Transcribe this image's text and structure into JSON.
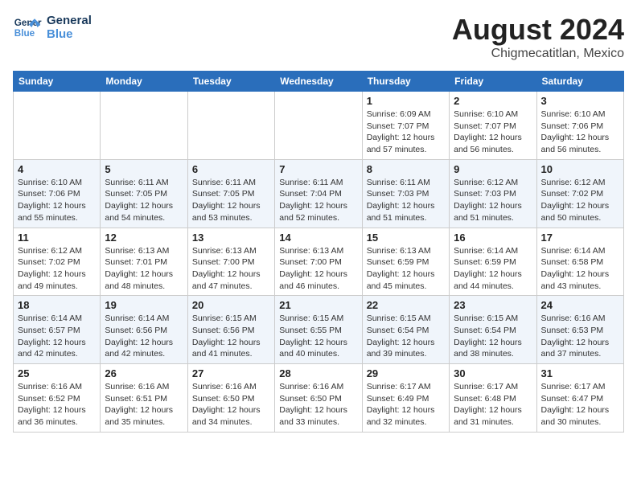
{
  "header": {
    "logo_line1": "General",
    "logo_line2": "Blue",
    "month_year": "August 2024",
    "location": "Chigmecatitlan, Mexico"
  },
  "days_of_week": [
    "Sunday",
    "Monday",
    "Tuesday",
    "Wednesday",
    "Thursday",
    "Friday",
    "Saturday"
  ],
  "weeks": [
    [
      {
        "day": "",
        "info": ""
      },
      {
        "day": "",
        "info": ""
      },
      {
        "day": "",
        "info": ""
      },
      {
        "day": "",
        "info": ""
      },
      {
        "day": "1",
        "info": "Sunrise: 6:09 AM\nSunset: 7:07 PM\nDaylight: 12 hours\nand 57 minutes."
      },
      {
        "day": "2",
        "info": "Sunrise: 6:10 AM\nSunset: 7:07 PM\nDaylight: 12 hours\nand 56 minutes."
      },
      {
        "day": "3",
        "info": "Sunrise: 6:10 AM\nSunset: 7:06 PM\nDaylight: 12 hours\nand 56 minutes."
      }
    ],
    [
      {
        "day": "4",
        "info": "Sunrise: 6:10 AM\nSunset: 7:06 PM\nDaylight: 12 hours\nand 55 minutes."
      },
      {
        "day": "5",
        "info": "Sunrise: 6:11 AM\nSunset: 7:05 PM\nDaylight: 12 hours\nand 54 minutes."
      },
      {
        "day": "6",
        "info": "Sunrise: 6:11 AM\nSunset: 7:05 PM\nDaylight: 12 hours\nand 53 minutes."
      },
      {
        "day": "7",
        "info": "Sunrise: 6:11 AM\nSunset: 7:04 PM\nDaylight: 12 hours\nand 52 minutes."
      },
      {
        "day": "8",
        "info": "Sunrise: 6:11 AM\nSunset: 7:03 PM\nDaylight: 12 hours\nand 51 minutes."
      },
      {
        "day": "9",
        "info": "Sunrise: 6:12 AM\nSunset: 7:03 PM\nDaylight: 12 hours\nand 51 minutes."
      },
      {
        "day": "10",
        "info": "Sunrise: 6:12 AM\nSunset: 7:02 PM\nDaylight: 12 hours\nand 50 minutes."
      }
    ],
    [
      {
        "day": "11",
        "info": "Sunrise: 6:12 AM\nSunset: 7:02 PM\nDaylight: 12 hours\nand 49 minutes."
      },
      {
        "day": "12",
        "info": "Sunrise: 6:13 AM\nSunset: 7:01 PM\nDaylight: 12 hours\nand 48 minutes."
      },
      {
        "day": "13",
        "info": "Sunrise: 6:13 AM\nSunset: 7:00 PM\nDaylight: 12 hours\nand 47 minutes."
      },
      {
        "day": "14",
        "info": "Sunrise: 6:13 AM\nSunset: 7:00 PM\nDaylight: 12 hours\nand 46 minutes."
      },
      {
        "day": "15",
        "info": "Sunrise: 6:13 AM\nSunset: 6:59 PM\nDaylight: 12 hours\nand 45 minutes."
      },
      {
        "day": "16",
        "info": "Sunrise: 6:14 AM\nSunset: 6:59 PM\nDaylight: 12 hours\nand 44 minutes."
      },
      {
        "day": "17",
        "info": "Sunrise: 6:14 AM\nSunset: 6:58 PM\nDaylight: 12 hours\nand 43 minutes."
      }
    ],
    [
      {
        "day": "18",
        "info": "Sunrise: 6:14 AM\nSunset: 6:57 PM\nDaylight: 12 hours\nand 42 minutes."
      },
      {
        "day": "19",
        "info": "Sunrise: 6:14 AM\nSunset: 6:56 PM\nDaylight: 12 hours\nand 42 minutes."
      },
      {
        "day": "20",
        "info": "Sunrise: 6:15 AM\nSunset: 6:56 PM\nDaylight: 12 hours\nand 41 minutes."
      },
      {
        "day": "21",
        "info": "Sunrise: 6:15 AM\nSunset: 6:55 PM\nDaylight: 12 hours\nand 40 minutes."
      },
      {
        "day": "22",
        "info": "Sunrise: 6:15 AM\nSunset: 6:54 PM\nDaylight: 12 hours\nand 39 minutes."
      },
      {
        "day": "23",
        "info": "Sunrise: 6:15 AM\nSunset: 6:54 PM\nDaylight: 12 hours\nand 38 minutes."
      },
      {
        "day": "24",
        "info": "Sunrise: 6:16 AM\nSunset: 6:53 PM\nDaylight: 12 hours\nand 37 minutes."
      }
    ],
    [
      {
        "day": "25",
        "info": "Sunrise: 6:16 AM\nSunset: 6:52 PM\nDaylight: 12 hours\nand 36 minutes."
      },
      {
        "day": "26",
        "info": "Sunrise: 6:16 AM\nSunset: 6:51 PM\nDaylight: 12 hours\nand 35 minutes."
      },
      {
        "day": "27",
        "info": "Sunrise: 6:16 AM\nSunset: 6:50 PM\nDaylight: 12 hours\nand 34 minutes."
      },
      {
        "day": "28",
        "info": "Sunrise: 6:16 AM\nSunset: 6:50 PM\nDaylight: 12 hours\nand 33 minutes."
      },
      {
        "day": "29",
        "info": "Sunrise: 6:17 AM\nSunset: 6:49 PM\nDaylight: 12 hours\nand 32 minutes."
      },
      {
        "day": "30",
        "info": "Sunrise: 6:17 AM\nSunset: 6:48 PM\nDaylight: 12 hours\nand 31 minutes."
      },
      {
        "day": "31",
        "info": "Sunrise: 6:17 AM\nSunset: 6:47 PM\nDaylight: 12 hours\nand 30 minutes."
      }
    ]
  ]
}
